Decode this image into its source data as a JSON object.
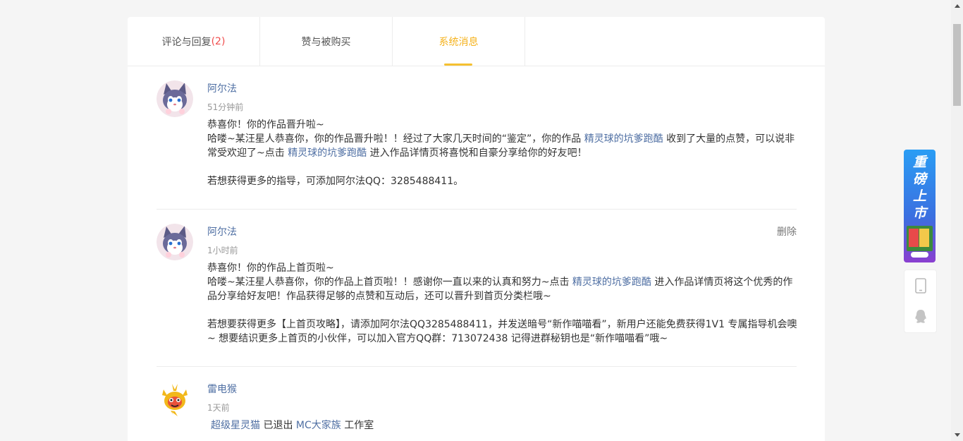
{
  "tabs": [
    {
      "label": "评论与回复",
      "count": "(2)"
    },
    {
      "label": "赞与被购买"
    },
    {
      "label": "系统消息"
    }
  ],
  "messages": [
    {
      "sender": "阿尔法",
      "time": "51分钟前",
      "line1": "恭喜你！你的作品晋升啦~",
      "line2_a": "哈喽~某汪星人恭喜你，你的作品晋升啦！！经过了大家几天时间的“鉴定”，你的作品 ",
      "link1": "精灵球的坑爹跑酷",
      "line2_b": " 收到了大量的点赞，可以说非常受欢迎了~点击 ",
      "link2": "精灵球的坑爹跑酷",
      "line2_c": " 进入作品详情页将喜悦和自豪分享给你的好友吧！",
      "line3": "若想获得更多的指导，可添加阿尔法QQ：3285488411。"
    },
    {
      "sender": "阿尔法",
      "time": "1小时前",
      "delete_label": "删除",
      "line1": "恭喜你！你的作品上首页啦~",
      "line2_a": "哈喽~某汪星人恭喜你，你的作品上首页啦！！感谢你一直以来的认真和努力~点击 ",
      "link1": "精灵球的坑爹跑酷",
      "line2_b": " 进入作品详情页将这个优秀的作品分享给好友吧！作品获得足够的点赞和互动后，还可以晋升到首页分类栏哦~",
      "line3": "若想要获得更多【上首页攻略】，请添加阿尔法QQ3285488411，并发送暗号“新作喵喵看”，新用户还能免费获得1V1 专属指导机会噢~ 想要结识更多上首页的小伙伴，可以加入官方QQ群：713072438 记得进群秘钥也是“新作喵喵看”哦~"
    },
    {
      "sender": "雷电猴",
      "time": "1天前",
      "link1": "超级星灵猫",
      "text1": " 已退出 ",
      "link2": "MC大家族",
      "text2": " 工作室"
    }
  ],
  "promo": {
    "text": [
      "重",
      "磅",
      "上",
      "市"
    ]
  },
  "colors": {
    "accent": "#f5b21c",
    "link": "#4f6fa3",
    "count": "#f04d4d"
  },
  "icons": {
    "phone": "mobile-icon",
    "qq": "qq-penguin-icon"
  }
}
